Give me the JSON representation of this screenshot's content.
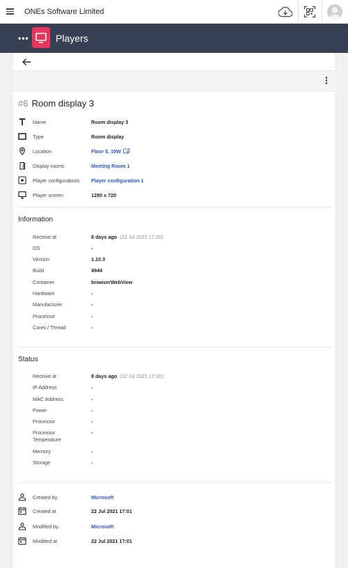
{
  "topbar": {
    "company": "ONEs Software Limited",
    "icons": [
      "menu-icon",
      "cloud-download-icon",
      "qr-scan-icon",
      "avatar"
    ]
  },
  "appbar": {
    "title": "Players",
    "icon": "tv-icon"
  },
  "player": {
    "number": "#6",
    "name": "Room display 3"
  },
  "details": [
    {
      "icon": "text-icon",
      "label": "Name",
      "value": "Room display 3",
      "link": false
    },
    {
      "icon": "display-icon",
      "label": "Type",
      "value": "Room display",
      "link": false
    },
    {
      "icon": "location-pin-icon",
      "label": "Location",
      "value": "Floor 5,  19W",
      "link": true
    },
    {
      "icon": "door-icon",
      "label": "Display rooms",
      "value": "Meeting Room 1",
      "link": true
    },
    {
      "icon": "settings-box-icon",
      "label": "Player configurations",
      "value": "Player configuration 1",
      "link": true
    },
    {
      "icon": "monitor-icon",
      "label": "Player screen",
      "value": "1280 x 720",
      "link": false
    }
  ],
  "information": {
    "title": "Information",
    "rows": [
      {
        "label": "Receive at",
        "value": "8 days ago",
        "extra": "(22 Jul 2021 17:20)"
      },
      {
        "label": "OS",
        "value": "-"
      },
      {
        "label": "Version",
        "value": "1.10.3"
      },
      {
        "label": "Build",
        "value": "4944"
      },
      {
        "label": "Container",
        "value": "browserWebView"
      },
      {
        "label": "Hardware",
        "value": "-"
      },
      {
        "label": "Manufacturer",
        "value": "-"
      },
      {
        "label": "Processor",
        "value": "-"
      },
      {
        "label": "Cores / Thread",
        "value": "-"
      }
    ]
  },
  "status": {
    "title": "Status",
    "rows": [
      {
        "label": "Receive at",
        "value": "8 days ago",
        "extra": "(22 Jul 2021 17:20)"
      },
      {
        "label": "IP Address",
        "value": "-"
      },
      {
        "label": "MAC Address",
        "value": "-"
      },
      {
        "label": "Power",
        "value": "-"
      },
      {
        "label": "Processor",
        "value": "-"
      },
      {
        "label": "Processor Temperature",
        "value": "-"
      },
      {
        "label": "Memory",
        "value": "-"
      },
      {
        "label": "Storage",
        "value": "-"
      }
    ]
  },
  "audit": [
    {
      "icon": "person-icon",
      "label": "Created by",
      "value": "Microsoft",
      "link": true
    },
    {
      "icon": "calendar-icon",
      "label": "Created at",
      "value": "22 Jul 2021 17:01",
      "link": false
    },
    {
      "icon": "person-icon",
      "label": "Modified by",
      "value": "Microsoft",
      "link": true
    },
    {
      "icon": "calendar-icon",
      "label": "Modified at",
      "value": "22 Jul 2021 17:01",
      "link": false
    }
  ],
  "colors": {
    "appbar": "#384154",
    "accent": "#e8365d",
    "link": "#2d55c4"
  }
}
